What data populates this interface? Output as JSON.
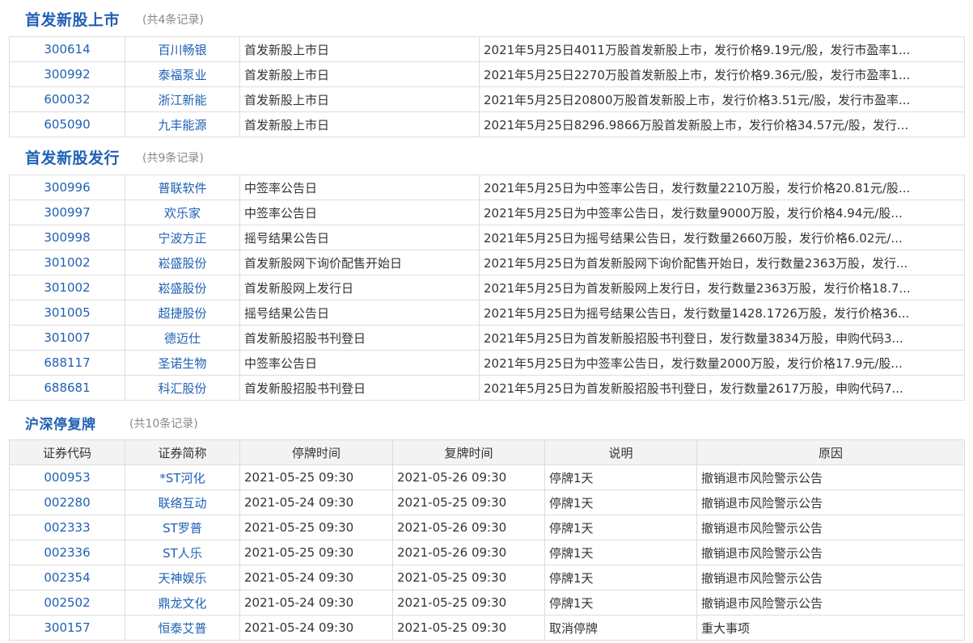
{
  "sections": {
    "ipo_listing": {
      "title": "首发新股上市",
      "count": "(共4条记录)",
      "rows": [
        {
          "code": "300614",
          "name": "百川畅银",
          "event": "首发新股上市日",
          "detail": "2021年5月25日4011万股首发新股上市，发行价格9.19元/股，发行市盈率1..."
        },
        {
          "code": "300992",
          "name": "泰福泵业",
          "event": "首发新股上市日",
          "detail": "2021年5月25日2270万股首发新股上市，发行价格9.36元/股，发行市盈率1..."
        },
        {
          "code": "600032",
          "name": "浙江新能",
          "event": "首发新股上市日",
          "detail": "2021年5月25日20800万股首发新股上市，发行价格3.51元/股，发行市盈率..."
        },
        {
          "code": "605090",
          "name": "九丰能源",
          "event": "首发新股上市日",
          "detail": "2021年5月25日8296.9866万股首发新股上市，发行价格34.57元/股，发行..."
        }
      ]
    },
    "ipo_issue": {
      "title": "首发新股发行",
      "count": "(共9条记录)",
      "rows": [
        {
          "code": "300996",
          "name": "普联软件",
          "event": "中签率公告日",
          "detail": "2021年5月25日为中签率公告日，发行数量2210万股，发行价格20.81元/股..."
        },
        {
          "code": "300997",
          "name": "欢乐家",
          "event": "中签率公告日",
          "detail": "2021年5月25日为中签率公告日，发行数量9000万股，发行价格4.94元/股..."
        },
        {
          "code": "300998",
          "name": "宁波方正",
          "event": "摇号结果公告日",
          "detail": "2021年5月25日为摇号结果公告日，发行数量2660万股，发行价格6.02元/..."
        },
        {
          "code": "301002",
          "name": "崧盛股份",
          "event": "首发新股网下询价配售开始日",
          "detail": "2021年5月25日为首发新股网下询价配售开始日，发行数量2363万股，发行..."
        },
        {
          "code": "301002",
          "name": "崧盛股份",
          "event": "首发新股网上发行日",
          "detail": "2021年5月25日为首发新股网上发行日，发行数量2363万股，发行价格18.7..."
        },
        {
          "code": "301005",
          "name": "超捷股份",
          "event": "摇号结果公告日",
          "detail": "2021年5月25日为摇号结果公告日，发行数量1428.1726万股，发行价格36..."
        },
        {
          "code": "301007",
          "name": "德迈仕",
          "event": "首发新股招股书刊登日",
          "detail": "2021年5月25日为首发新股招股书刊登日，发行数量3834万股，申购代码3..."
        },
        {
          "code": "688117",
          "name": "圣诺生物",
          "event": "中签率公告日",
          "detail": "2021年5月25日为中签率公告日，发行数量2000万股，发行价格17.9元/股..."
        },
        {
          "code": "688681",
          "name": "科汇股份",
          "event": "首发新股招股书刊登日",
          "detail": "2021年5月25日为首发新股招股书刊登日，发行数量2617万股，申购代码7..."
        }
      ]
    },
    "suspension": {
      "title": "沪深停复牌",
      "count": "(共10条记录)",
      "headers": [
        "证券代码",
        "证券简称",
        "停牌时间",
        "复牌时间",
        "说明",
        "原因"
      ],
      "rows": [
        {
          "code": "000953",
          "name": "*ST河化",
          "halt": "2021-05-25 09:30",
          "resume": "2021-05-26 09:30",
          "note": "停牌1天",
          "reason": "撤销退市风险警示公告"
        },
        {
          "code": "002280",
          "name": "联络互动",
          "halt": "2021-05-24 09:30",
          "resume": "2021-05-25 09:30",
          "note": "停牌1天",
          "reason": "撤销退市风险警示公告"
        },
        {
          "code": "002333",
          "name": "ST罗普",
          "halt": "2021-05-25 09:30",
          "resume": "2021-05-26 09:30",
          "note": "停牌1天",
          "reason": "撤销退市风险警示公告"
        },
        {
          "code": "002336",
          "name": "ST人乐",
          "halt": "2021-05-25 09:30",
          "resume": "2021-05-26 09:30",
          "note": "停牌1天",
          "reason": "撤销退市风险警示公告"
        },
        {
          "code": "002354",
          "name": "天神娱乐",
          "halt": "2021-05-24 09:30",
          "resume": "2021-05-25 09:30",
          "note": "停牌1天",
          "reason": "撤销退市风险警示公告"
        },
        {
          "code": "002502",
          "name": "鼎龙文化",
          "halt": "2021-05-24 09:30",
          "resume": "2021-05-25 09:30",
          "note": "停牌1天",
          "reason": "撤销退市风险警示公告"
        },
        {
          "code": "300157",
          "name": "恒泰艾普",
          "halt": "2021-05-24 09:30",
          "resume": "2021-05-25 09:30",
          "note": "取消停牌",
          "reason": "重大事项"
        }
      ]
    }
  },
  "colors": {
    "link": "#1f60b4",
    "header_bg": "#f3f3f3",
    "border": "#dddddd",
    "muted": "#888888"
  }
}
